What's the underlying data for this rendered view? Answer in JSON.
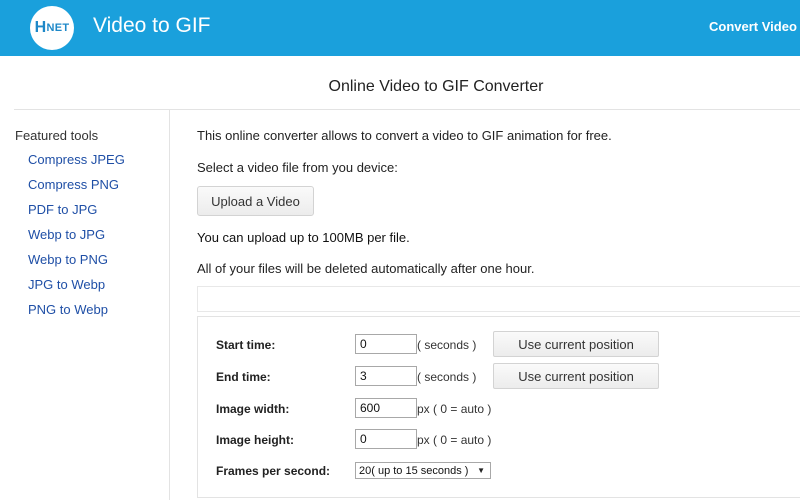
{
  "header": {
    "logo_text": "HNET",
    "logo_first": "H",
    "logo_rest": "NET",
    "app_title": "Video to GIF",
    "nav_link": "Convert Video to"
  },
  "page_title": "Online Video to GIF Converter",
  "sidebar": {
    "heading": "Featured tools",
    "items": [
      {
        "label": "Compress JPEG"
      },
      {
        "label": "Compress PNG"
      },
      {
        "label": "PDF to JPG"
      },
      {
        "label": "Webp to JPG"
      },
      {
        "label": "Webp to PNG"
      },
      {
        "label": "JPG to Webp"
      },
      {
        "label": "PNG to Webp"
      }
    ]
  },
  "main": {
    "intro": "This online converter allows to convert a video to GIF animation for free.",
    "select_text": "Select a video file from you device:",
    "upload_label": "Upload a Video",
    "limit_text": "You can upload up to 100MB per file.",
    "delete_text": "All of your files will be deleted automatically after one hour."
  },
  "options": {
    "start_time": {
      "label": "Start time:",
      "value": "0",
      "unit": "( seconds )",
      "button": "Use current position"
    },
    "end_time": {
      "label": "End time:",
      "value": "3",
      "unit": "( seconds )",
      "button": "Use current position"
    },
    "image_width": {
      "label": "Image width:",
      "value": "600",
      "unit": "px ( 0 = auto )"
    },
    "image_height": {
      "label": "Image height:",
      "value": "0",
      "unit": "px ( 0 = auto )"
    },
    "fps": {
      "label": "Frames per second:",
      "selected": "20( up to 15 seconds )"
    }
  },
  "colors": {
    "header_bg": "#1aa0dc",
    "link": "#1f4fa6"
  }
}
